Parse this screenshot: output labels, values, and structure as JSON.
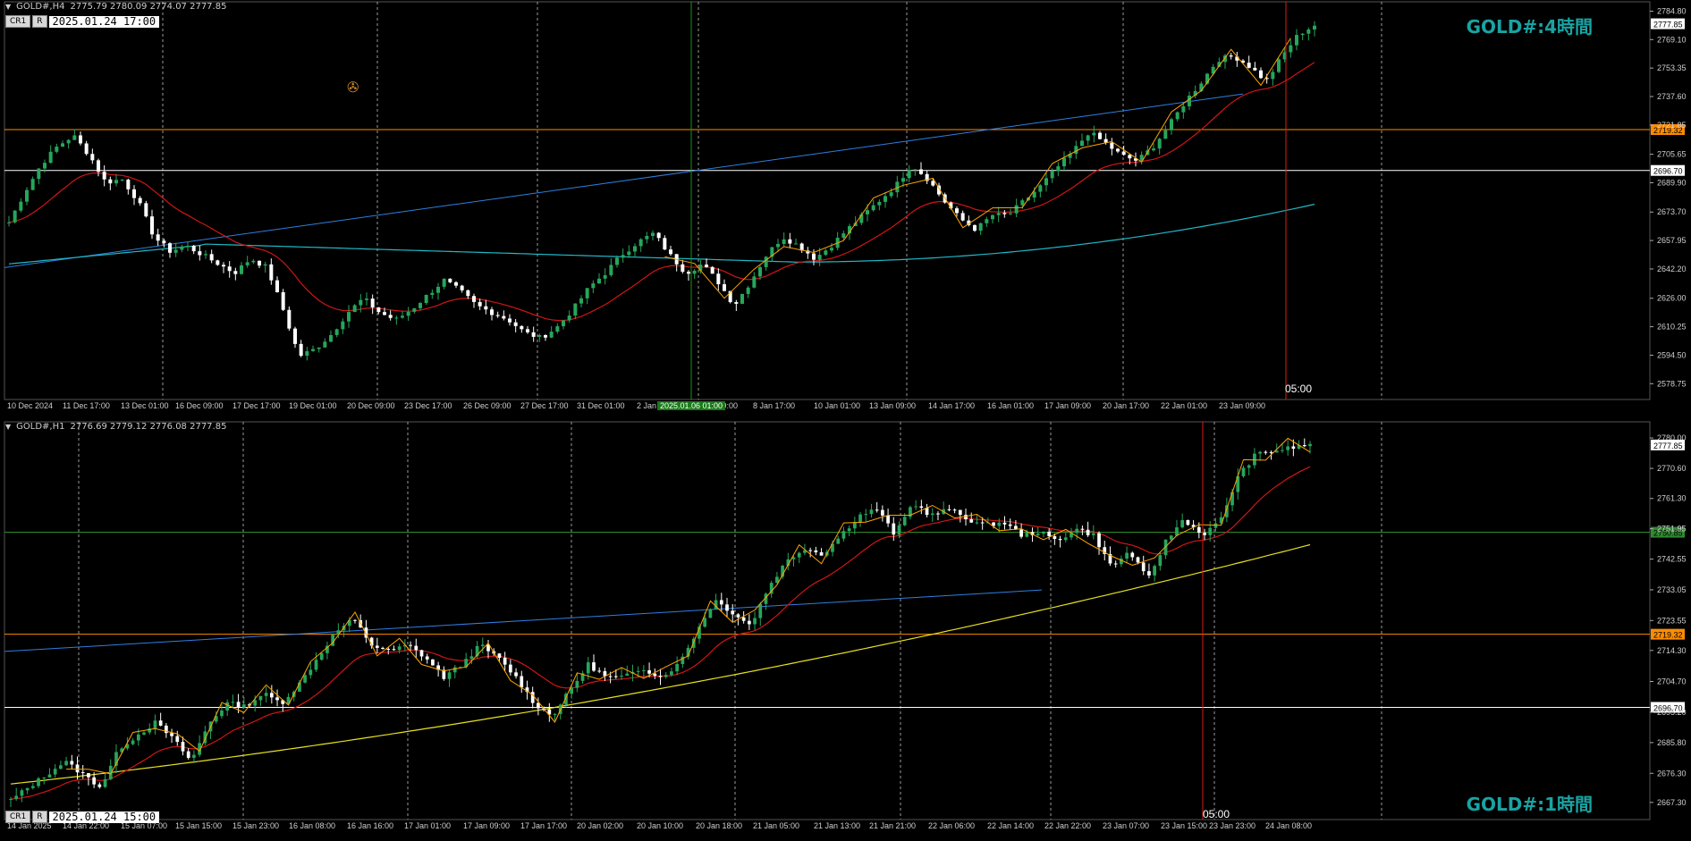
{
  "colors": {
    "background": "#000000",
    "bull": "#26a65b",
    "bear": "#ffffff",
    "ma_fast": "#d01616",
    "ma_slow_top": "#21b8c7",
    "ma_slow_bottom": "#e8e021",
    "trendline": "#2f7fe0",
    "zigzag": "#ffa500",
    "level_orange": "#ff8c00",
    "level_white": "#ffffff",
    "level_green": "#2e8b2e",
    "vline_red": "#e01a1a",
    "vline_green": "#1f8f1f",
    "grid": "#9a9a9a",
    "watermark": "#1aa3a3"
  },
  "top": {
    "symbol_header": "GOLD#,H4",
    "ohlc": "2775.79 2780.09 2774.07 2777.85",
    "tag_cr1": "CR1",
    "tag_r": "R",
    "datetime": "2025.01.24 17:00",
    "watermark": "GOLD#:4時間",
    "now_label": "05:00",
    "green_vline_date": "2025.01.06 01:00"
  },
  "bottom": {
    "symbol_header": "GOLD#,H1",
    "ohlc": "2776.69 2779.12 2776.08 2777.85",
    "tag_cr1": "CR1",
    "tag_r": "R",
    "datetime": "2025.01.24 15:00",
    "watermark": "GOLD#:1時間",
    "now_label": "05:00"
  },
  "chart_data": [
    {
      "type": "candlestick",
      "panel": "top",
      "timeframe": "H4",
      "ylim": [
        2570,
        2790
      ],
      "y_ticks": [
        2784.8,
        2769.1,
        2753.35,
        2737.6,
        2721.85,
        2705.65,
        2689.9,
        2673.7,
        2657.95,
        2642.2,
        2626.0,
        2610.25,
        2594.5,
        2578.75
      ],
      "x_ticks": [
        "10 Dec 2024",
        "11 Dec 17:00",
        "13 Dec 01:00",
        "16 Dec 09:00",
        "17 Dec 17:00",
        "19 Dec 01:00",
        "20 Dec 09:00",
        "23 Dec 17:00",
        "26 Dec 09:00",
        "27 Dec 17:00",
        "31 Dec 01:00",
        "2 Jan",
        "7 Jan 09:00",
        "8 Jan 17:00",
        "10 Jan 01:00",
        "13 Jan 09:00",
        "14 Jan 17:00",
        "16 Jan 01:00",
        "17 Jan 09:00",
        "20 Jan 17:00",
        "22 Jan 01:00",
        "23 Jan 09:00"
      ],
      "levels": [
        {
          "price": 2719.32,
          "label": "2719.32",
          "color": "orange"
        },
        {
          "price": 2696.7,
          "label": "2696.70",
          "color": "white"
        }
      ],
      "current_price": "2777.85",
      "close_path": [
        2668,
        2685,
        2700,
        2710,
        2716,
        2705,
        2690,
        2692,
        2680,
        2660,
        2652,
        2655,
        2650,
        2645,
        2640,
        2648,
        2643,
        2620,
        2594,
        2598,
        2606,
        2618,
        2626,
        2618,
        2614,
        2620,
        2628,
        2636,
        2630,
        2622,
        2618,
        2614,
        2607,
        2604,
        2610,
        2620,
        2632,
        2640,
        2650,
        2657,
        2662,
        2650,
        2640,
        2645,
        2635,
        2622,
        2635,
        2650,
        2660,
        2655,
        2648,
        2655,
        2664,
        2672,
        2680,
        2688,
        2700,
        2692,
        2680,
        2670,
        2664,
        2672,
        2672,
        2680,
        2688,
        2698,
        2707,
        2718,
        2712,
        2705,
        2702,
        2710,
        2722,
        2735,
        2746,
        2758,
        2760,
        2754,
        2746,
        2760,
        2772,
        2777
      ]
    },
    {
      "type": "candlestick",
      "panel": "bottom",
      "timeframe": "H1",
      "ylim": [
        2662,
        2785
      ],
      "y_ticks": [
        2780.0,
        2770.6,
        2761.3,
        2751.95,
        2742.55,
        2733.05,
        2723.55,
        2714.3,
        2704.7,
        2695.2,
        2685.8,
        2676.3,
        2667.3
      ],
      "x_ticks": [
        "14 Jan 2025",
        "14 Jan 22:00",
        "15 Jan 07:00",
        "15 Jan 15:00",
        "15 Jan 23:00",
        "16 Jan 08:00",
        "16 Jan 16:00",
        "17 Jan 01:00",
        "17 Jan 09:00",
        "17 Jan 17:00",
        "20 Jan 02:00",
        "20 Jan 10:00",
        "20 Jan 18:00",
        "21 Jan 05:00",
        "21 Jan 13:00",
        "21 Jan 21:00",
        "22 Jan 06:00",
        "22 Jan 14:00",
        "22 Jan 22:00",
        "23 Jan 07:00",
        "23 Jan 15:00",
        "23 Jan 23:00",
        "24 Jan 08:00"
      ],
      "levels": [
        {
          "price": 2750.85,
          "label": "2750.85",
          "color": "green"
        },
        {
          "price": 2719.32,
          "label": "2719.32",
          "color": "orange"
        },
        {
          "price": 2696.7,
          "label": "2696.70",
          "color": "white"
        }
      ],
      "current_price": "2777.85",
      "close_path": [
        2668,
        2672,
        2676,
        2680,
        2676,
        2672,
        2684,
        2688,
        2692,
        2687,
        2680,
        2692,
        2698,
        2697,
        2701,
        2698,
        2704,
        2712,
        2720,
        2724,
        2716,
        2714,
        2716,
        2712,
        2706,
        2710,
        2716,
        2712,
        2706,
        2698,
        2694,
        2702,
        2710,
        2706,
        2706,
        2709,
        2706,
        2710,
        2720,
        2730,
        2726,
        2722,
        2734,
        2742,
        2746,
        2744,
        2750,
        2756,
        2758,
        2750,
        2760,
        2756,
        2758,
        2755,
        2753,
        2754,
        2750,
        2751,
        2748,
        2752,
        2750,
        2740,
        2745,
        2736,
        2748,
        2755,
        2750,
        2754,
        2768,
        2775,
        2776,
        2777,
        2778
      ]
    }
  ]
}
